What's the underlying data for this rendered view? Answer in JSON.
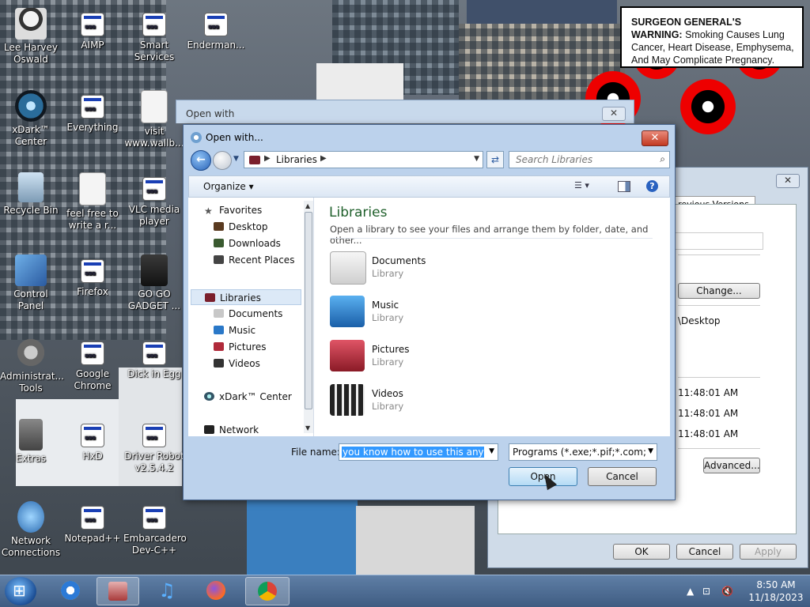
{
  "warning": {
    "heading": "SURGEON GENERAL'S WARNING:",
    "body": "Smoking Causes Lung Cancer, Heart Disease, Emphysema, And May Complicate Pregnancy."
  },
  "desktop_icons": [
    {
      "label": "Lee Harvey Oswald"
    },
    {
      "label": "AIMP"
    },
    {
      "label": "Smart Services"
    },
    {
      "label": "Enderman..."
    },
    {
      "label": "xDark™ Center"
    },
    {
      "label": "Everything"
    },
    {
      "label": "visit www.wallb..."
    },
    {
      "label": "Recycle Bin"
    },
    {
      "label": "feel free to write a r..."
    },
    {
      "label": "VLC media player"
    },
    {
      "label": "Control Panel"
    },
    {
      "label": "Firefox"
    },
    {
      "label": "GO GO GADGET ..."
    },
    {
      "label": "Administrat... Tools"
    },
    {
      "label": "Google Chrome"
    },
    {
      "label": "Dick in Egg"
    },
    {
      "label": "Extras"
    },
    {
      "label": "HxD"
    },
    {
      "label": "Driver Robot v2.5.4.2"
    },
    {
      "label": "Network Connections"
    },
    {
      "label": "Notepad++"
    },
    {
      "label": "Embarcadero Dev-C++"
    }
  ],
  "props_window": {
    "tab": "revious Versions",
    "change_button": "Change...",
    "location_text": "\\Desktop",
    "times": [
      "11:48:01 AM",
      "11:48:01 AM",
      "11:48:01 AM"
    ],
    "advanced_button": "Advanced...",
    "ok": "OK",
    "cancel": "Cancel",
    "apply": "Apply"
  },
  "openwith_outer": {
    "title": "Open with"
  },
  "dialog": {
    "title": "Open with...",
    "address": {
      "crumb": "Libraries"
    },
    "search_placeholder": "Search Libraries",
    "toolbar": {
      "organize": "Organize"
    },
    "nav": {
      "favorites": "Favorites",
      "fav_items": [
        "Desktop",
        "Downloads",
        "Recent Places"
      ],
      "libraries": "Libraries",
      "lib_items": [
        "Documents",
        "Music",
        "Pictures",
        "Videos"
      ],
      "xdark": "xDark™ Center",
      "network": "Network"
    },
    "content": {
      "heading": "Libraries",
      "subtitle": "Open a library to see your files and arrange them by folder, date, and other...",
      "libraries": [
        {
          "name": "Documents",
          "type": "Library"
        },
        {
          "name": "Music",
          "type": "Library"
        },
        {
          "name": "Pictures",
          "type": "Library"
        },
        {
          "name": "Videos",
          "type": "Library"
        }
      ]
    },
    "file_name_label": "File name:",
    "file_name_value": "you know how to use this anyway",
    "filter_value": "Programs (*.exe;*.pif;*.com;*.ba",
    "open_button": "Open",
    "cancel_button": "Cancel"
  },
  "taskbar": {
    "time": "8:50 AM",
    "date": "11/18/2023"
  }
}
